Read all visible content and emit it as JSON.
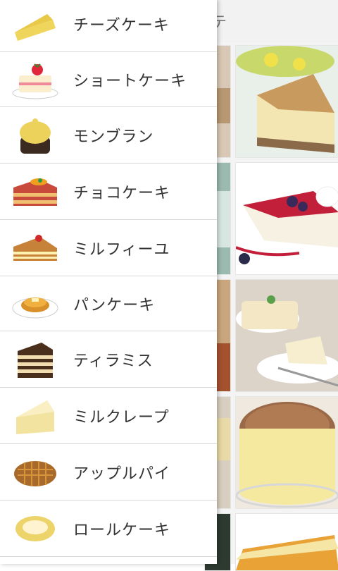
{
  "header": {
    "title_fragment": "テ"
  },
  "menu": {
    "items": [
      {
        "label": "チーズケーキ",
        "icon": "cheesecake-icon"
      },
      {
        "label": "ショートケーキ",
        "icon": "shortcake-icon"
      },
      {
        "label": "モンブラン",
        "icon": "montblanc-icon"
      },
      {
        "label": "チョコケーキ",
        "icon": "chocolate-cake-icon"
      },
      {
        "label": "ミルフィーユ",
        "icon": "millefeuille-icon"
      },
      {
        "label": "パンケーキ",
        "icon": "pancake-icon"
      },
      {
        "label": "ティラミス",
        "icon": "tiramisu-icon"
      },
      {
        "label": "ミルクレープ",
        "icon": "mille-crepe-icon"
      },
      {
        "label": "アップルパイ",
        "icon": "apple-pie-icon"
      },
      {
        "label": "ロールケーキ",
        "icon": "roll-cake-icon"
      }
    ]
  },
  "colors": {
    "divider": "#d9d9d9",
    "text": "#333333"
  }
}
